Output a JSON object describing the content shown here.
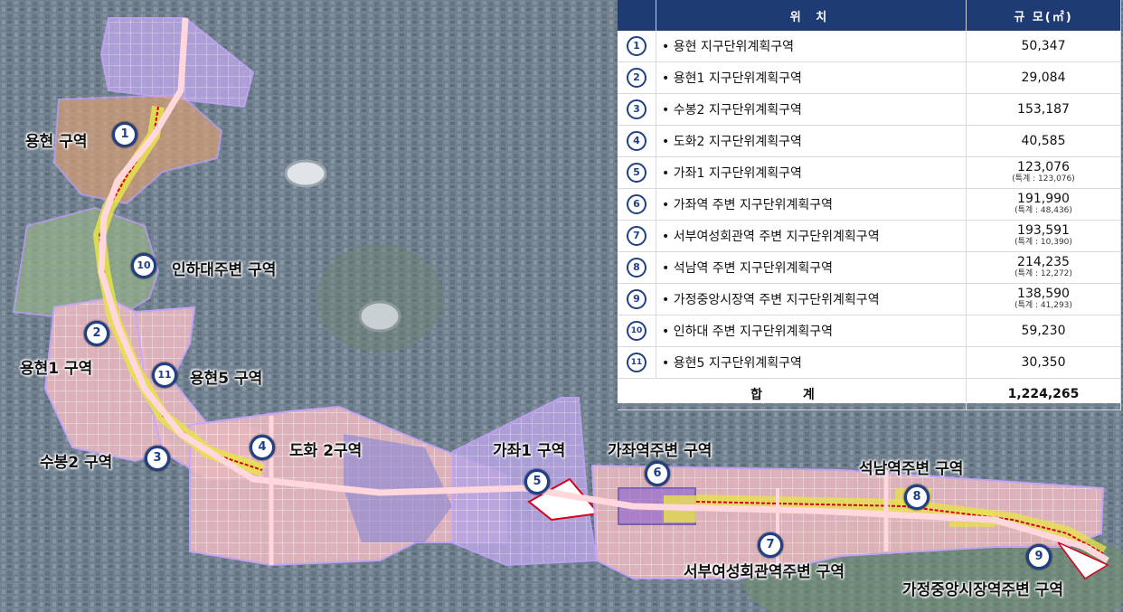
{
  "table": {
    "header_location": "위 치",
    "header_area": "규 모(㎡)",
    "rows": [
      {
        "no": "1",
        "name": "• 용현 지구단위계획구역",
        "area": "50,347",
        "sub": ""
      },
      {
        "no": "2",
        "name": "• 용현1 지구단위계획구역",
        "area": "29,084",
        "sub": ""
      },
      {
        "no": "3",
        "name": "• 수봉2 지구단위계획구역",
        "area": "153,187",
        "sub": ""
      },
      {
        "no": "4",
        "name": "• 도화2 지구단위계획구역",
        "area": "40,585",
        "sub": ""
      },
      {
        "no": "5",
        "name": "• 가좌1 지구단위계획구역",
        "area": "123,076",
        "sub": "(특계 : 123,076)"
      },
      {
        "no": "6",
        "name": "• 가좌역 주변 지구단위계획구역",
        "area": "191,990",
        "sub": "(특계 : 48,436)"
      },
      {
        "no": "7",
        "name": "• 서부여성회관역 주변 지구단위계획구역",
        "area": "193,591",
        "sub": "(특계 : 10,390)"
      },
      {
        "no": "8",
        "name": "• 석남역 주변 지구단위계획구역",
        "area": "214,235",
        "sub": "(특계 : 12,272)"
      },
      {
        "no": "9",
        "name": "• 가정중앙시장역 주변 지구단위계획구역",
        "area": "138,590",
        "sub": "(특계 : 41,293)"
      },
      {
        "no": "10",
        "name": "• 인하대 주변 지구단위계획구역",
        "area": "59,230",
        "sub": ""
      },
      {
        "no": "11",
        "name": "• 용현5 지구단위계획구역",
        "area": "30,350",
        "sub": ""
      }
    ],
    "total_label": "합 계",
    "total_value": "1,224,265"
  },
  "map": {
    "labels": {
      "yonghyeon": "용현 구역",
      "inha": "인하대주변 구역",
      "yonghyeon1": "용현1 구역",
      "yonghyeon5": "용현5 구역",
      "subong2": "수봉2 구역",
      "dohwa2": "도화 2구역",
      "gajwa1": "가좌1 구역",
      "gajwa_station": "가좌역주변 구역",
      "seoknam": "석남역주변 구역",
      "seobu": "서부여성회관역주변 구역",
      "gajeong": "가정중앙시장역주변 구역"
    },
    "markers": {
      "m1": "1",
      "m2": "2",
      "m3": "3",
      "m4": "4",
      "m5": "5",
      "m6": "6",
      "m7": "7",
      "m8": "8",
      "m9": "9",
      "m10": "10",
      "m11": "11"
    }
  },
  "colors": {
    "header_bg": "#1f3b73",
    "marker_border": "#1f3f86",
    "zone_outline": "#c9a6ff",
    "district_fill": "#f4c2c8",
    "corridor_fill": "#e8e34a",
    "road": "#ffd7dc",
    "boundary_red": "#d4001c"
  }
}
